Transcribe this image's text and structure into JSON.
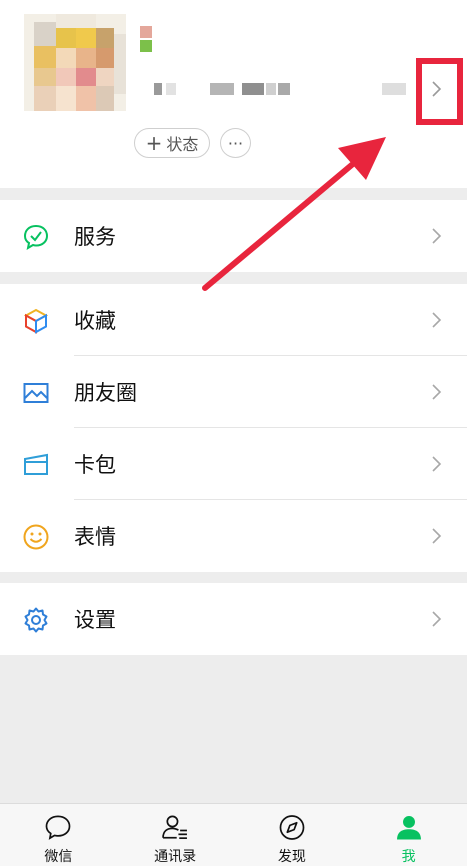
{
  "profile": {
    "status_label": "状态",
    "more_label": "···"
  },
  "menu": {
    "services": {
      "label": "服务",
      "icon": "services-icon"
    },
    "favorites": {
      "label": "收藏",
      "icon": "favorites-cube-icon"
    },
    "moments": {
      "label": "朋友圈",
      "icon": "moments-image-icon"
    },
    "cards": {
      "label": "卡包",
      "icon": "card-wallet-icon"
    },
    "stickers": {
      "label": "表情",
      "icon": "smiley-icon"
    },
    "settings": {
      "label": "设置",
      "icon": "gear-icon"
    }
  },
  "tabbar": {
    "tabs": [
      {
        "label": "微信",
        "icon": "chat-bubble-icon",
        "active": false
      },
      {
        "label": "通讯录",
        "icon": "contacts-icon",
        "active": false
      },
      {
        "label": "发现",
        "icon": "compass-icon",
        "active": false
      },
      {
        "label": "我",
        "icon": "person-icon",
        "active": true
      }
    ]
  },
  "colors": {
    "accent_green": "#07c160",
    "annotation_red": "#e8253d",
    "background": "#ededed"
  }
}
